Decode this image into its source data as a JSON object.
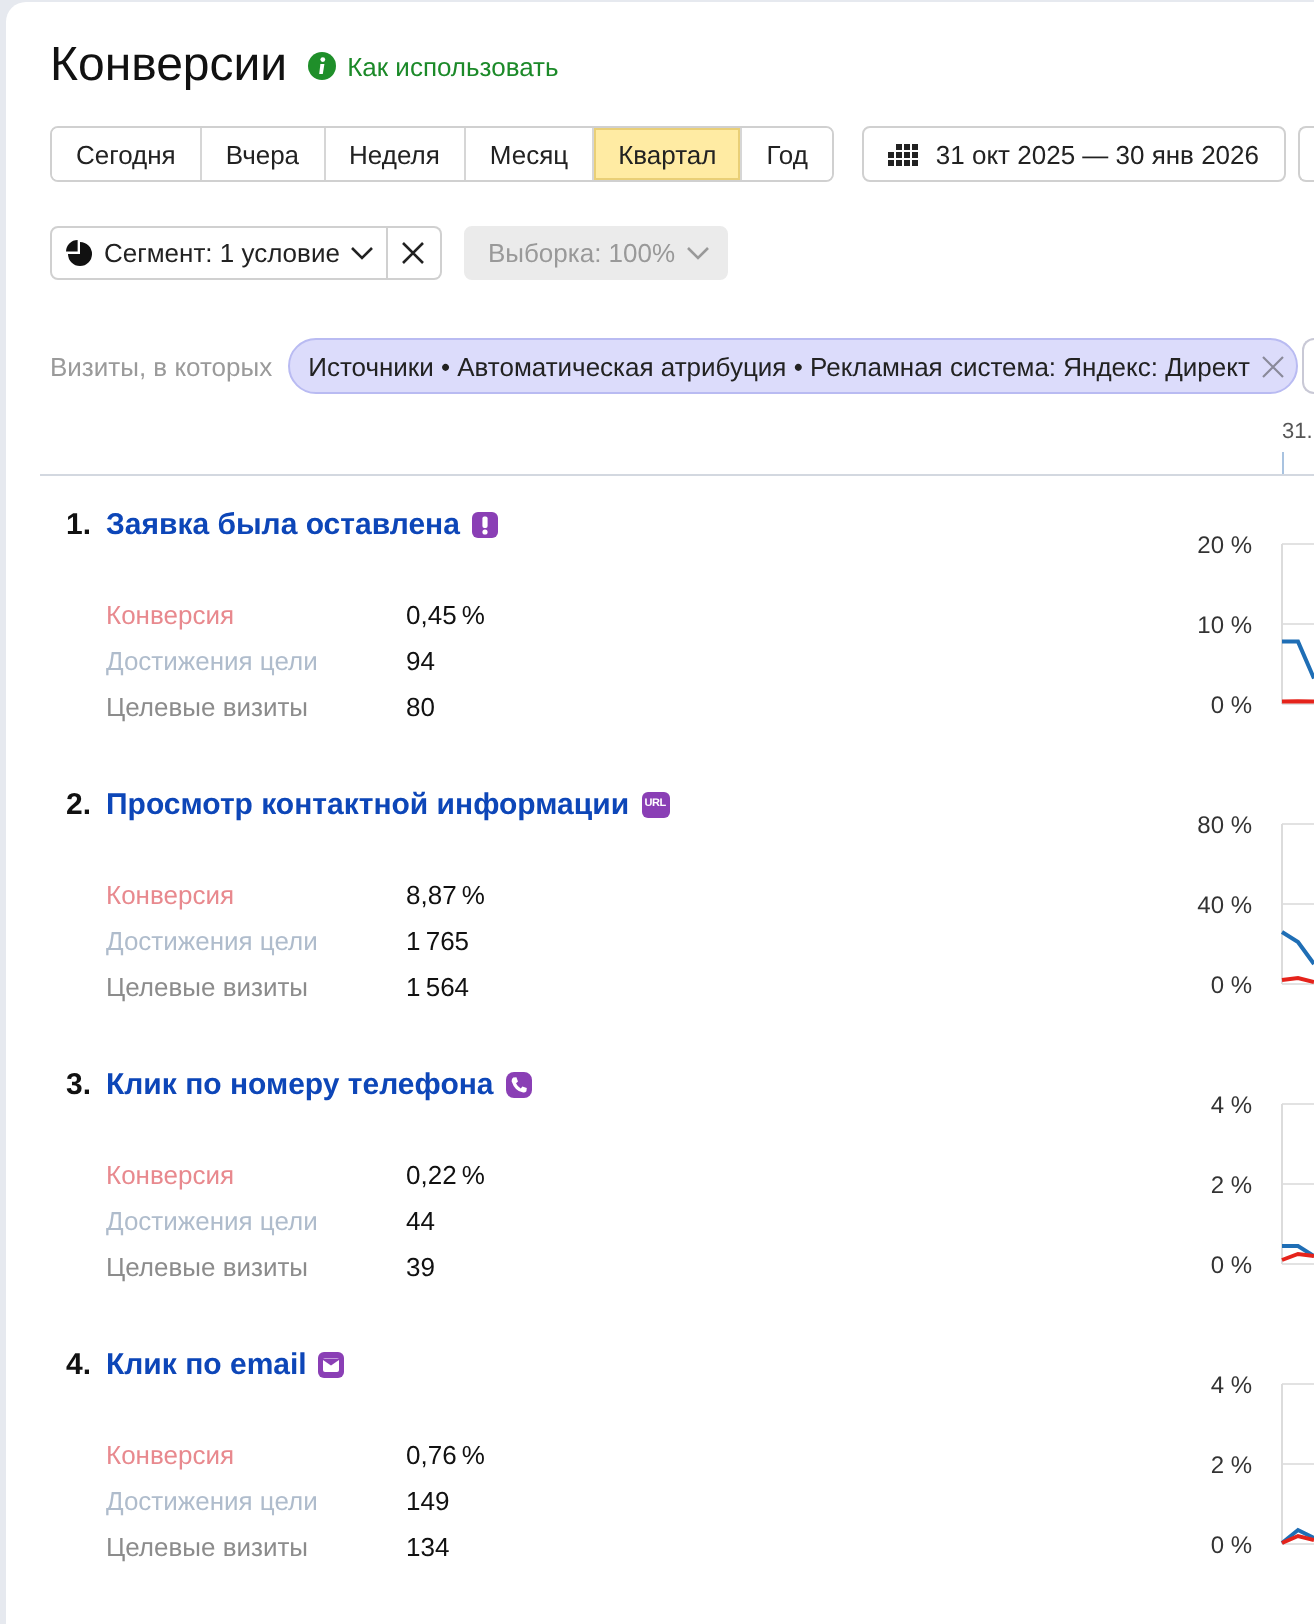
{
  "header": {
    "title": "Конверсии",
    "help_link": "Как использовать"
  },
  "periods": [
    {
      "label": "Сегодня",
      "selected": false
    },
    {
      "label": "Вчера",
      "selected": false
    },
    {
      "label": "Неделя",
      "selected": false
    },
    {
      "label": "Месяц",
      "selected": false
    },
    {
      "label": "Квартал",
      "selected": true
    },
    {
      "label": "Год",
      "selected": false
    }
  ],
  "date_range": {
    "label": "31 окт 2025 — 30 янв 2026"
  },
  "segment": {
    "label": "Сегмент: 1 условие"
  },
  "sample": {
    "label": "Выборка: 100%",
    "disabled": true
  },
  "filter": {
    "label": "Визиты, в которых",
    "chips": [
      {
        "text": "Источники • Автоматическая атрибуция • Рекламная система: Яндекс: Директ"
      }
    ]
  },
  "timeline": {
    "date_label": "31."
  },
  "goals": [
    {
      "number": "1.",
      "title": "Заявка была оставлена",
      "kind": "form",
      "metrics": [
        {
          "label": "Конверсия",
          "value": "0,45 %",
          "color": "#e8898e"
        },
        {
          "label": "Достижения цели",
          "value": "94",
          "color": "#afbccc"
        },
        {
          "label": "Целевые визиты",
          "value": "80",
          "color": "#8c8c8c"
        }
      ],
      "chart": {
        "axis_labels": [
          "20 %",
          "10 %",
          "0 %"
        ],
        "lines": [
          {
            "color": "#1f6eb5"
          },
          {
            "color": "#e5231b"
          }
        ]
      }
    },
    {
      "number": "2.",
      "title": "Просмотр контактной информации",
      "kind": "url",
      "icon_label": "URL",
      "metrics": [
        {
          "label": "Конверсия",
          "value": "8,87 %",
          "color": "#e8898e"
        },
        {
          "label": "Достижения цели",
          "value": "1 765",
          "color": "#afbccc"
        },
        {
          "label": "Целевые визиты",
          "value": "1 564",
          "color": "#8c8c8c"
        }
      ],
      "chart": {
        "axis_labels": [
          "80 %",
          "40 %",
          "0 %"
        ],
        "lines": [
          {
            "color": "#1f6eb5"
          },
          {
            "color": "#e5231b"
          }
        ]
      }
    },
    {
      "number": "3.",
      "title": "Клик по номеру телефона",
      "kind": "phone",
      "metrics": [
        {
          "label": "Конверсия",
          "value": "0,22 %",
          "color": "#e8898e"
        },
        {
          "label": "Достижения цели",
          "value": "44",
          "color": "#afbccc"
        },
        {
          "label": "Целевые визиты",
          "value": "39",
          "color": "#8c8c8c"
        }
      ],
      "chart": {
        "axis_labels": [
          "4 %",
          "2 %",
          "0 %"
        ],
        "lines": [
          {
            "color": "#1f6eb5"
          },
          {
            "color": "#e5231b"
          }
        ]
      }
    },
    {
      "number": "4.",
      "title": "Клик по email",
      "kind": "email",
      "metrics": [
        {
          "label": "Конверсия",
          "value": "0,76 %",
          "color": "#e8898e"
        },
        {
          "label": "Достижения цели",
          "value": "149",
          "color": "#afbccc"
        },
        {
          "label": "Целевые визиты",
          "value": "134",
          "color": "#8c8c8c"
        }
      ],
      "chart": {
        "axis_labels": [
          "4 %",
          "2 %",
          "0 %"
        ],
        "lines": [
          {
            "color": "#1f6eb5"
          },
          {
            "color": "#e5231b"
          }
        ]
      }
    }
  ]
}
